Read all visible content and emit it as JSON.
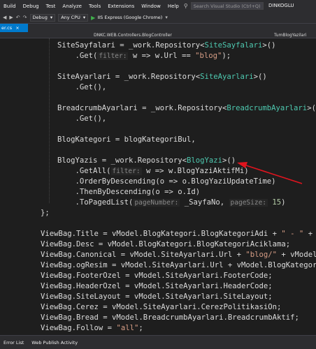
{
  "menubar": {
    "items": [
      "Build",
      "Debug",
      "Test",
      "Analyze",
      "Tools",
      "Extensions",
      "Window",
      "Help"
    ],
    "search_placeholder": "Search Visual Studio (Ctrl+Q)",
    "user": "DINKOGLU"
  },
  "toolbar": {
    "config": "Debug",
    "platform": "Any CPU",
    "run_target": "IIS Express (Google Chrome)"
  },
  "tabs": {
    "active_doc": "er.cs"
  },
  "navigation": {
    "project": "DNKC.WEB.Controllers.BlogController",
    "member": "TumBlogYazilari"
  },
  "code": {
    "lines": [
      [
        [
          "SiteSayfalari = _work.Repository<",
          "w"
        ],
        [
          "SiteSayfalari",
          "t"
        ],
        [
          ">()",
          "w"
        ]
      ],
      [
        [
          "    .Get(",
          "w"
        ],
        [
          "filter:",
          "h"
        ],
        [
          " w => w.Url == ",
          "w"
        ],
        [
          "\"blog\"",
          "s"
        ],
        [
          ");",
          "w"
        ]
      ],
      [],
      [
        [
          "SiteAyarlari = _work.Repository<",
          "w"
        ],
        [
          "SiteAyarlari",
          "t"
        ],
        [
          ">()",
          "w"
        ]
      ],
      [
        [
          "    .Get(),",
          "w"
        ]
      ],
      [],
      [
        [
          "BreadcrumbAyarlari = _work.Repository<",
          "w"
        ],
        [
          "BreadcrumbAyarlari",
          "t"
        ],
        [
          ">()",
          "w"
        ]
      ],
      [
        [
          "    .Get(),",
          "w"
        ]
      ],
      [],
      [
        [
          "BlogKategori = blogKategoriBul,",
          "w"
        ]
      ],
      [],
      [
        [
          "BlogYazis = _work.Repository<",
          "w"
        ],
        [
          "BlogYazi",
          "t"
        ],
        [
          ">()",
          "w"
        ]
      ],
      [
        [
          "    .GetAll(",
          "w"
        ],
        [
          "filter:",
          "h"
        ],
        [
          " w => w.BlogYaziAktifMi)",
          "w"
        ]
      ],
      [
        [
          "    .OrderByDescending(o => o.BlogYaziUpdateTime)",
          "w"
        ]
      ],
      [
        [
          "    .ThenByDescending(o => o.Id)",
          "w"
        ]
      ],
      [
        [
          "    .ToPagedList(",
          "w"
        ],
        [
          "pageNumber:",
          "h"
        ],
        [
          " _SayfaNo, ",
          "w"
        ],
        [
          "pageSize:",
          "h"
        ],
        [
          " ",
          "w"
        ],
        [
          "15",
          "n"
        ],
        [
          ")",
          "w"
        ]
      ],
      [
        [
          "};",
          "w"
        ]
      ],
      [],
      [
        [
          "ViewBag.Title = vModel.BlogKategori.BlogKategoriAdi + ",
          "w"
        ],
        [
          "\" - \"",
          "s"
        ],
        [
          " + vM",
          "w"
        ]
      ],
      [
        [
          "ViewBag.Desc = vModel.BlogKategori.BlogKategoriAciklama;",
          "w"
        ]
      ],
      [
        [
          "ViewBag.Canonical = vModel.SiteAyarlari.Url + ",
          "w"
        ],
        [
          "\"blog/\"",
          "s"
        ],
        [
          " + vModel.B",
          "w"
        ]
      ],
      [
        [
          "ViewBag.ogResim = vModel.SiteAyarlari.Url + vModel.BlogKategori.",
          "w"
        ]
      ],
      [
        [
          "ViewBag.FooterOzel = vModel.SiteAyarlari.FooterCode;",
          "w"
        ]
      ],
      [
        [
          "ViewBag.HeaderOzel = vModel.SiteAyarlari.HeaderCode;",
          "w"
        ]
      ],
      [
        [
          "ViewBag.SiteLayout = vModel.SiteAyarlari.SiteLayout;",
          "w"
        ]
      ],
      [
        [
          "ViewBag.Cerez = vModel.SiteAyarlari.CerezPolitikasiOn;",
          "w"
        ]
      ],
      [
        [
          "ViewBag.Bread = vModel.BreadcrumbAyarlari.BreadcrumbAktif;",
          "w"
        ]
      ],
      [
        [
          "ViewBag.Follow = ",
          "w"
        ],
        [
          "\"all\"",
          "s"
        ],
        [
          ";",
          "w"
        ]
      ]
    ]
  },
  "statusbar": {
    "items": [
      "Error List",
      "Web Publish Activity"
    ]
  }
}
